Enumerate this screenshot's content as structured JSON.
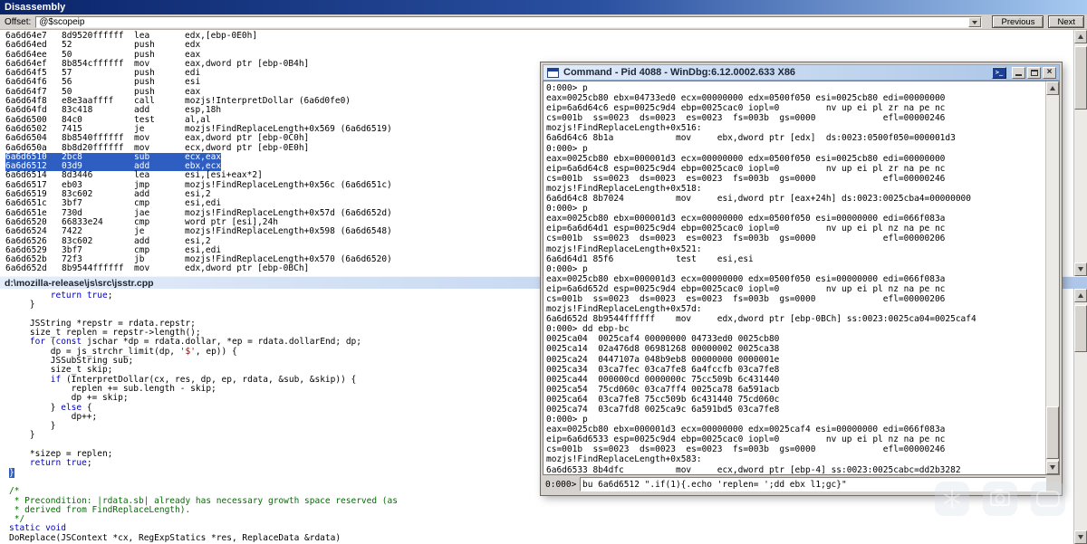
{
  "colors": {
    "chrome-gray": "#d6d3ce",
    "selection-blue": "#2f5ec2",
    "title-dark-left": "#0a246a",
    "title-dark-right": "#a6caf0",
    "title-light-left": "#e4edfa",
    "title-light-right": "#aec6e8",
    "keyword-blue": "#0000cc",
    "comment-green": "#007000",
    "string-red": "#a00000"
  },
  "icons": {
    "close_glyph": "×",
    "dock_glyph": ">_"
  },
  "disassembly_window": {
    "title": "Disassembly",
    "toolbar": {
      "offset_label": "Offset:",
      "offset_value": "@$scopeip",
      "previous_button": "Previous",
      "next_button": "Next"
    },
    "lines": [
      {
        "a": "6a6d64e7",
        "b": "8d9520ffffff",
        "m": "lea",
        "o": "edx,[ebp-0E0h]",
        "cls": ""
      },
      {
        "a": "6a6d64ed",
        "b": "52",
        "m": "push",
        "o": "edx",
        "cls": ""
      },
      {
        "a": "6a6d64ee",
        "b": "50",
        "m": "push",
        "o": "eax",
        "cls": ""
      },
      {
        "a": "6a6d64ef",
        "b": "8b854cffffff",
        "m": "mov",
        "o": "eax,dword ptr [ebp-0B4h]",
        "cls": ""
      },
      {
        "a": "6a6d64f5",
        "b": "57",
        "m": "push",
        "o": "edi",
        "cls": ""
      },
      {
        "a": "6a6d64f6",
        "b": "56",
        "m": "push",
        "o": "esi",
        "cls": ""
      },
      {
        "a": "6a6d64f7",
        "b": "50",
        "m": "push",
        "o": "eax",
        "cls": ""
      },
      {
        "a": "6a6d64f8",
        "b": "e8e3aaffff",
        "m": "call",
        "o": "mozjs!InterpretDollar (6a6d0fe0)",
        "cls": ""
      },
      {
        "a": "6a6d64fd",
        "b": "83c418",
        "m": "add",
        "o": "esp,18h",
        "cls": ""
      },
      {
        "a": "6a6d6500",
        "b": "84c0",
        "m": "test",
        "o": "al,al",
        "cls": ""
      },
      {
        "a": "6a6d6502",
        "b": "7415",
        "m": "je",
        "o": "mozjs!FindReplaceLength+0x569 (6a6d6519)",
        "cls": ""
      },
      {
        "a": "6a6d6504",
        "b": "8b8540ffffff",
        "m": "mov",
        "o": "eax,dword ptr [ebp-0C0h]",
        "cls": ""
      },
      {
        "a": "6a6d650a",
        "b": "8b8d20ffffff",
        "m": "mov",
        "o": "ecx,dword ptr [ebp-0E0h]",
        "cls": ""
      },
      {
        "a": "6a6d6510",
        "b": "2bc8",
        "m": "sub",
        "o": "ecx,eax",
        "cls": "hl"
      },
      {
        "a": "6a6d6512",
        "b": "03d9",
        "m": "add",
        "o": "ebx,ecx",
        "cls": "hl"
      },
      {
        "a": "6a6d6514",
        "b": "8d3446",
        "m": "lea",
        "o": "esi,[esi+eax*2]",
        "cls": ""
      },
      {
        "a": "6a6d6517",
        "b": "eb03",
        "m": "jmp",
        "o": "mozjs!FindReplaceLength+0x56c (6a6d651c)",
        "cls": ""
      },
      {
        "a": "6a6d6519",
        "b": "83c602",
        "m": "add",
        "o": "esi,2",
        "cls": ""
      },
      {
        "a": "6a6d651c",
        "b": "3bf7",
        "m": "cmp",
        "o": "esi,edi",
        "cls": ""
      },
      {
        "a": "6a6d651e",
        "b": "730d",
        "m": "jae",
        "o": "mozjs!FindReplaceLength+0x57d (6a6d652d)",
        "cls": ""
      },
      {
        "a": "6a6d6520",
        "b": "66833e24",
        "m": "cmp",
        "o": "word ptr [esi],24h",
        "cls": ""
      },
      {
        "a": "6a6d6524",
        "b": "7422",
        "m": "je",
        "o": "mozjs!FindReplaceLength+0x598 (6a6d6548)",
        "cls": ""
      },
      {
        "a": "6a6d6526",
        "b": "83c602",
        "m": "add",
        "o": "esi,2",
        "cls": ""
      },
      {
        "a": "6a6d6529",
        "b": "3bf7",
        "m": "cmp",
        "o": "esi,edi",
        "cls": ""
      },
      {
        "a": "6a6d652b",
        "b": "72f3",
        "m": "jb",
        "o": "mozjs!FindReplaceLength+0x570 (6a6d6520)",
        "cls": ""
      },
      {
        "a": "6a6d652d",
        "b": "8b9544ffffff",
        "m": "mov",
        "o": "edx,dword ptr [ebp-0BCh]",
        "cls": ""
      }
    ]
  },
  "source_window": {
    "title": "d:\\mozilla-release\\js\\src\\jsstr.cpp",
    "lines": [
      {
        "segs": [
          {
            "t": "        ",
            "c": "p"
          },
          {
            "t": "return",
            "c": "k"
          },
          {
            "t": " ",
            "c": "p"
          },
          {
            "t": "true",
            "c": "k"
          },
          {
            "t": ";",
            "c": "p"
          }
        ]
      },
      {
        "segs": [
          {
            "t": "    }",
            "c": "p"
          }
        ]
      },
      {
        "segs": [
          {
            "t": " ",
            "c": "p"
          }
        ]
      },
      {
        "segs": [
          {
            "t": "    JSString *repstr = rdata.repstr;",
            "c": "p"
          }
        ]
      },
      {
        "segs": [
          {
            "t": "    size_t replen = repstr->length();",
            "c": "p"
          }
        ]
      },
      {
        "segs": [
          {
            "t": "    ",
            "c": "p"
          },
          {
            "t": "for",
            "c": "k"
          },
          {
            "t": " (",
            "c": "p"
          },
          {
            "t": "const",
            "c": "k"
          },
          {
            "t": " jschar *dp = rdata.dollar, *ep = rdata.dollarEnd; dp;",
            "c": "p"
          }
        ]
      },
      {
        "segs": [
          {
            "t": "        dp = js_strchr_limit(dp, ",
            "c": "p"
          },
          {
            "t": "'$'",
            "c": "s"
          },
          {
            "t": ", ep)) {",
            "c": "p"
          }
        ]
      },
      {
        "segs": [
          {
            "t": "        JSSubString sub;",
            "c": "p"
          }
        ]
      },
      {
        "segs": [
          {
            "t": "        size_t skip;",
            "c": "p"
          }
        ]
      },
      {
        "segs": [
          {
            "t": "        ",
            "c": "p"
          },
          {
            "t": "if",
            "c": "k"
          },
          {
            "t": " (InterpretDollar(cx, res, dp, ep, rdata, &sub, &skip)) {",
            "c": "p"
          }
        ]
      },
      {
        "segs": [
          {
            "t": "            replen += sub.length - skip;",
            "c": "p"
          }
        ]
      },
      {
        "segs": [
          {
            "t": "            dp += skip;",
            "c": "p"
          }
        ]
      },
      {
        "segs": [
          {
            "t": "        } ",
            "c": "p"
          },
          {
            "t": "else",
            "c": "k"
          },
          {
            "t": " {",
            "c": "p"
          }
        ]
      },
      {
        "segs": [
          {
            "t": "            dp++;",
            "c": "p"
          }
        ]
      },
      {
        "segs": [
          {
            "t": "        }",
            "c": "p"
          }
        ]
      },
      {
        "segs": [
          {
            "t": "    }",
            "c": "p"
          }
        ]
      },
      {
        "segs": [
          {
            "t": " ",
            "c": "p"
          }
        ]
      },
      {
        "segs": [
          {
            "t": "    *sizep = replen;",
            "c": "p"
          }
        ]
      },
      {
        "segs": [
          {
            "t": "    ",
            "c": "p"
          },
          {
            "t": "return",
            "c": "k"
          },
          {
            "t": " ",
            "c": "p"
          },
          {
            "t": "true",
            "c": "k"
          },
          {
            "t": ";",
            "c": "p"
          }
        ]
      },
      {
        "segs": [
          {
            "t": "}",
            "c": "sel"
          }
        ]
      },
      {
        "segs": [
          {
            "t": " ",
            "c": "p"
          }
        ]
      },
      {
        "segs": [
          {
            "t": "/*",
            "c": "g"
          }
        ]
      },
      {
        "segs": [
          {
            "t": " * Precondition: |rdata.sb| already has necessary growth space reserved (as",
            "c": "g"
          }
        ]
      },
      {
        "segs": [
          {
            "t": " * derived from FindReplaceLength).",
            "c": "g"
          }
        ]
      },
      {
        "segs": [
          {
            "t": " */",
            "c": "g"
          }
        ]
      },
      {
        "segs": [
          {
            "t": "static",
            "c": "k"
          },
          {
            "t": " ",
            "c": "p"
          },
          {
            "t": "void",
            "c": "k"
          }
        ]
      },
      {
        "segs": [
          {
            "t": "DoReplace(JSContext *cx, RegExpStatics *res, ReplaceData &rdata)",
            "c": "p"
          }
        ]
      }
    ]
  },
  "command_window": {
    "title": "Command - Pid 4088 - WinDbg:6.12.0002.633 X86",
    "prompt": "0:000>",
    "input_value": "bu 6a6d6512 \".if(1){.echo 'replen= ';dd ebx l1;gc}\"",
    "lines": [
      "0:000> p",
      "eax=0025cb80 ebx=04733ed0 ecx=00000000 edx=0500f050 esi=0025cb80 edi=00000000",
      "eip=6a6d64c6 esp=0025c9d4 ebp=0025cac0 iopl=0         nv up ei pl zr na pe nc",
      "cs=001b  ss=0023  ds=0023  es=0023  fs=003b  gs=0000             efl=00000246",
      "mozjs!FindReplaceLength+0x516:",
      "6a6d64c6 8b1a            mov     ebx,dword ptr [edx]  ds:0023:0500f050=000001d3",
      "0:000> p",
      "eax=0025cb80 ebx=000001d3 ecx=00000000 edx=0500f050 esi=0025cb80 edi=00000000",
      "eip=6a6d64c8 esp=0025c9d4 ebp=0025cac0 iopl=0         nv up ei pl zr na pe nc",
      "cs=001b  ss=0023  ds=0023  es=0023  fs=003b  gs=0000             efl=00000246",
      "mozjs!FindReplaceLength+0x518:",
      "6a6d64c8 8b7024          mov     esi,dword ptr [eax+24h] ds:0023:0025cba4=00000000",
      "0:000> p",
      "eax=0025cb80 ebx=000001d3 ecx=00000000 edx=0500f050 esi=00000000 edi=066f083a",
      "eip=6a6d64d1 esp=0025c9d4 ebp=0025cac0 iopl=0         nv up ei pl nz na pe nc",
      "cs=001b  ss=0023  ds=0023  es=0023  fs=003b  gs=0000             efl=00000206",
      "mozjs!FindReplaceLength+0x521:",
      "6a6d64d1 85f6            test    esi,esi",
      "0:000> p",
      "eax=0025cb80 ebx=000001d3 ecx=00000000 edx=0500f050 esi=00000000 edi=066f083a",
      "eip=6a6d652d esp=0025c9d4 ebp=0025cac0 iopl=0         nv up ei pl nz na pe nc",
      "cs=001b  ss=0023  ds=0023  es=0023  fs=003b  gs=0000             efl=00000206",
      "mozjs!FindReplaceLength+0x57d:",
      "6a6d652d 8b9544ffffff    mov     edx,dword ptr [ebp-0BCh] ss:0023:0025ca04=0025caf4",
      "0:000> dd ebp-bc",
      "0025ca04  0025caf4 00000000 04733ed0 0025cb80",
      "0025ca14  02a476d8 06981268 00000002 0025ca38",
      "0025ca24  0447107a 048b9eb8 00000000 0000001e",
      "0025ca34  03ca7fec 03ca7fe8 6a4fccfb 03ca7fe8",
      "0025ca44  000000cd 0000000c 75cc509b 6c431440",
      "0025ca54  75cd060c 03ca7ff4 0025ca78 6a591acb",
      "0025ca64  03ca7fe8 75cc509b 6c431440 75cd060c",
      "0025ca74  03ca7fd8 0025ca9c 6a591bd5 03ca7fe8",
      "0:000> p",
      "eax=0025cb80 ebx=000001d3 ecx=00000000 edx=0025caf4 esi=00000000 edi=066f083a",
      "eip=6a6d6533 esp=0025c9d4 ebp=0025cac0 iopl=0         nv up ei pl nz na pe nc",
      "cs=001b  ss=0023  ds=0023  es=0023  fs=003b  gs=0000             efl=00000246",
      "mozjs!FindReplaceLength+0x583:",
      "6a6d6533 8b4dfc          mov     ecx,dword ptr [ebp-4] ss:0023:0025cabc=dd2b3282"
    ]
  }
}
